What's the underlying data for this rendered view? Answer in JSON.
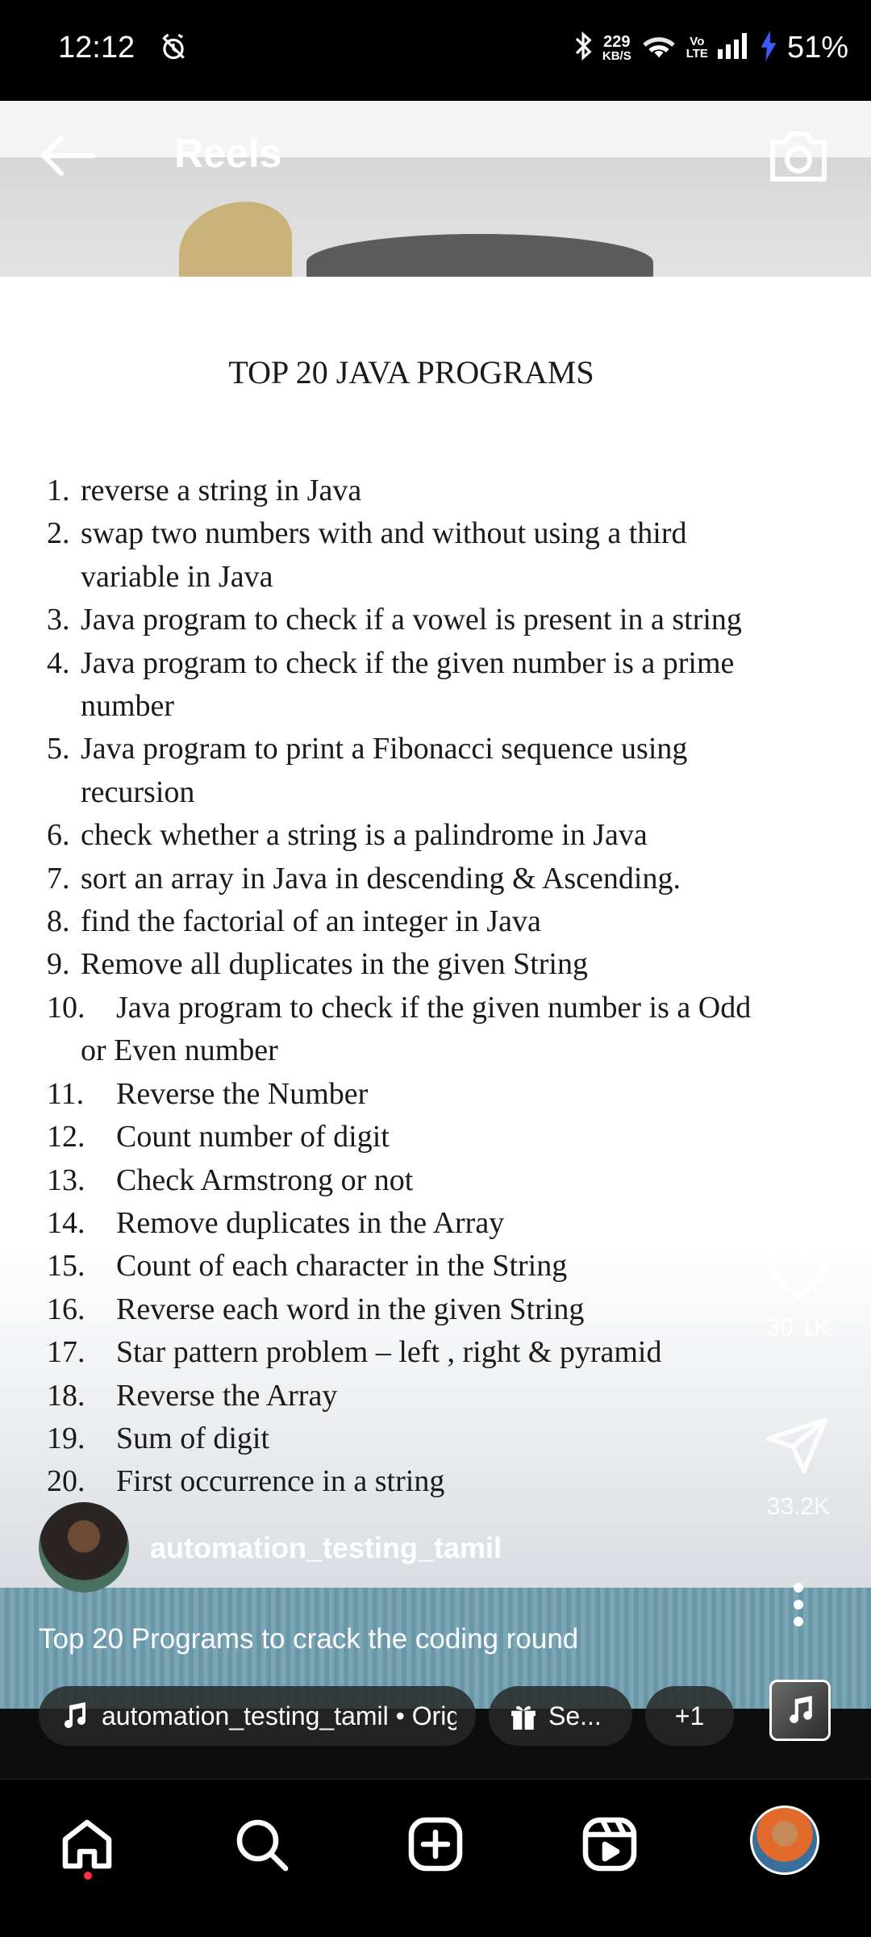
{
  "status_bar": {
    "time": "12:12",
    "net_speed_value": "229",
    "net_speed_unit": "KB/S",
    "volte_top": "Vo",
    "volte_bottom": "LTE",
    "battery": "51%"
  },
  "header": {
    "title": "Reels",
    "back_icon": "arrow-left-icon",
    "camera_icon": "camera-icon"
  },
  "video": {
    "document_title": "TOP 20 JAVA PROGRAMS",
    "programs": [
      {
        "num": "1.",
        "text": "reverse a string in Java"
      },
      {
        "num": "2.",
        "text": "swap two numbers with and without using a third"
      },
      {
        "num": "",
        "text": "variable in Java"
      },
      {
        "num": "3.",
        "text": "Java program to check if a vowel is present in a string"
      },
      {
        "num": "4.",
        "text": "Java program to check if the given number is a prime"
      },
      {
        "num": "",
        "text": "number"
      },
      {
        "num": "5.",
        "text": "Java program to print a Fibonacci sequence using"
      },
      {
        "num": "",
        "text": "recursion"
      },
      {
        "num": "6.",
        "text": "check whether a string is a palindrome in Java"
      },
      {
        "num": "7.",
        "text": "sort an array in Java in descending & Ascending."
      },
      {
        "num": "8.",
        "text": "find the factorial of an integer in Java"
      },
      {
        "num": "9.",
        "text": "Remove all duplicates in the given String"
      },
      {
        "num": "10.",
        "text": "Java program to check if the given number is a Odd"
      },
      {
        "num": "",
        "text": "or Even number"
      },
      {
        "num": "11.",
        "text": "Reverse the Number"
      },
      {
        "num": "12.",
        "text": "Count number of digit"
      },
      {
        "num": "13.",
        "text": "Check Armstrong or not"
      },
      {
        "num": "14.",
        "text": "Remove duplicates in the Array"
      },
      {
        "num": "15.",
        "text": "Count of each character in the String"
      },
      {
        "num": "16.",
        "text": "Reverse each word in the given String"
      },
      {
        "num": "17.",
        "text": "Star pattern problem – left , right & pyramid"
      },
      {
        "num": "18.",
        "text": "Reverse the Array"
      },
      {
        "num": "19.",
        "text": "Sum of digit"
      },
      {
        "num": "20.",
        "text": "First occurrence in a string"
      }
    ]
  },
  "actions": {
    "likes": "30.1K",
    "shares": "33.2K"
  },
  "post": {
    "username": "automation_testing_tamil",
    "caption": "Top 20 Programs to crack the coding round"
  },
  "chips": {
    "audio": "automation_testing_tamil • Orig",
    "gift": "Se...",
    "plus": "+1"
  },
  "nav": {
    "items": [
      "home-icon",
      "search-icon",
      "create-icon",
      "reels-icon",
      "profile-avatar"
    ],
    "active": "home",
    "active_dot_color": "#ff3040"
  }
}
